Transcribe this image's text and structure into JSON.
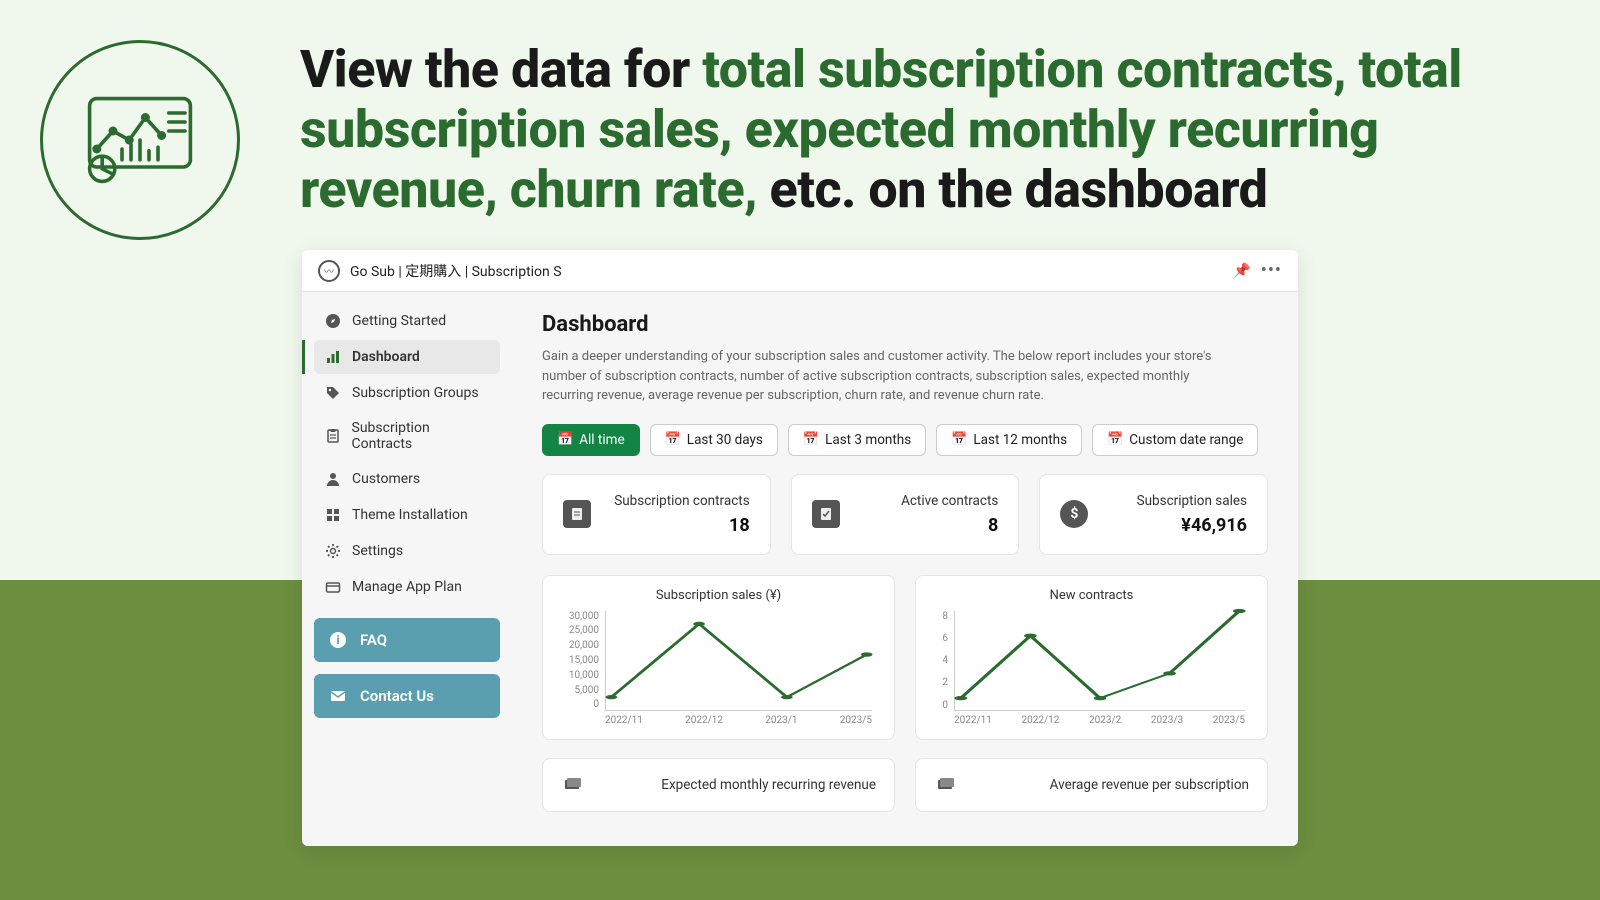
{
  "hero": {
    "pre": "View the data for ",
    "hl": "total subscription contracts, total subscription sales, expected monthly recurring revenue, churn rate, ",
    "post": "etc. on the dashboard"
  },
  "titlebar": {
    "title": "Go Sub | 定期購入 | Subscription S"
  },
  "sidebar": {
    "items": [
      {
        "label": "Getting Started"
      },
      {
        "label": "Dashboard"
      },
      {
        "label": "Subscription Groups"
      },
      {
        "label": "Subscription Contracts"
      },
      {
        "label": "Customers"
      },
      {
        "label": "Theme Installation"
      },
      {
        "label": "Settings"
      },
      {
        "label": "Manage App Plan"
      }
    ],
    "faq": "FAQ",
    "contact": "Contact Us"
  },
  "main": {
    "heading": "Dashboard",
    "desc": "Gain a deeper understanding of your subscription sales and customer activity. The below report includes your store's number of subscription contracts, number of active subscription contracts, subscription sales, expected monthly recurring revenue, average revenue per subscription, churn rate, and revenue churn rate."
  },
  "date_filters": [
    "All time",
    "Last 30 days",
    "Last 3 months",
    "Last 12 months",
    "Custom date range"
  ],
  "stats": [
    {
      "label": "Subscription contracts",
      "value": "18"
    },
    {
      "label": "Active contracts",
      "value": "8"
    },
    {
      "label": "Subscription sales",
      "value": "¥46,916"
    }
  ],
  "charts": {
    "sales": {
      "title": "Subscription sales (¥)",
      "yticks": [
        "30,000",
        "25,000",
        "20,000",
        "15,000",
        "10,000",
        "5,000",
        "0"
      ],
      "xticks": [
        "2022/11",
        "2022/12",
        "2023/1",
        "2023/5"
      ]
    },
    "newContracts": {
      "title": "New contracts",
      "yticks": [
        "8",
        "6",
        "4",
        "2",
        "0"
      ],
      "xticks": [
        "2022/11",
        "2022/12",
        "2023/2",
        "2023/3",
        "2023/5"
      ]
    },
    "mrr": {
      "title": "Expected monthly recurring revenue"
    },
    "arps": {
      "title": "Average revenue per subscription"
    }
  },
  "chart_data": [
    {
      "type": "line",
      "title": "Subscription sales (¥)",
      "x": [
        "2022/11",
        "2022/12",
        "2023/1",
        "2023/5"
      ],
      "values": [
        4000,
        26000,
        4000,
        17000
      ],
      "ylim": [
        0,
        30000
      ],
      "ylabel": "",
      "xlabel": ""
    },
    {
      "type": "line",
      "title": "New contracts",
      "x": [
        "2022/11",
        "2022/12",
        "2023/2",
        "2023/3",
        "2023/5"
      ],
      "values": [
        1,
        6,
        1,
        3,
        8
      ],
      "ylim": [
        0,
        8
      ],
      "ylabel": "",
      "xlabel": ""
    }
  ]
}
